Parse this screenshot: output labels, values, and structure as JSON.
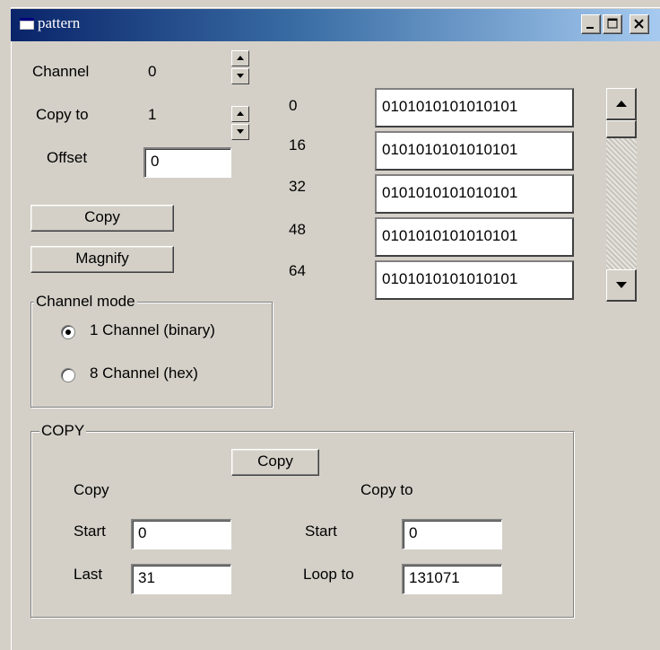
{
  "window": {
    "title": "pattern"
  },
  "top": {
    "channel_label": "Channel",
    "channel_value": "0",
    "copyto_label": "Copy to",
    "copyto_value": "1",
    "offset_label": "Offset",
    "offset_value": "0"
  },
  "buttons": {
    "copy": "Copy",
    "magnify": "Magnify"
  },
  "pattern_rows": [
    {
      "index": "0",
      "bits": "0101010101010101"
    },
    {
      "index": "16",
      "bits": "0101010101010101"
    },
    {
      "index": "32",
      "bits": "0101010101010101"
    },
    {
      "index": "48",
      "bits": "0101010101010101"
    },
    {
      "index": "64",
      "bits": "0101010101010101"
    }
  ],
  "channel_mode": {
    "legend": "Channel mode",
    "options": [
      {
        "label": "1 Channel (binary)",
        "selected": true
      },
      {
        "label": "8 Channel (hex)",
        "selected": false
      }
    ]
  },
  "copy_group": {
    "legend": "COPY",
    "button": "Copy",
    "left_title": "Copy",
    "right_title": "Copy to",
    "start_label": "Start",
    "start_value": "0",
    "last_label": "Last",
    "last_value": "31",
    "to_start_label": "Start",
    "to_start_value": "0",
    "loop_label": "Loop to",
    "loop_value": "131071"
  }
}
